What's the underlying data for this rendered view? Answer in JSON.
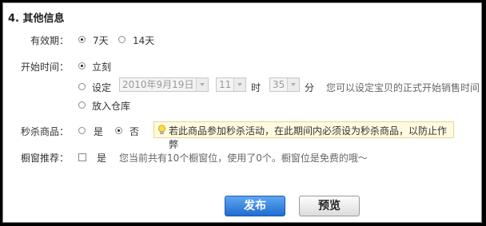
{
  "section_title": "4. 其他信息",
  "validity": {
    "label": "有效期：",
    "options": [
      {
        "label": "7天",
        "selected": true
      },
      {
        "label": "14天",
        "selected": false
      }
    ]
  },
  "start_time": {
    "label": "开始时间：",
    "immediate": {
      "label": "立刻",
      "selected": true
    },
    "scheduled": {
      "label": "设定",
      "selected": false
    },
    "date_value": "2010年9月19日",
    "hour_value": "11",
    "hour_unit": "时",
    "minute_value": "35",
    "minute_unit": "分",
    "hint": "您可以设定宝贝的正式开始销售时间",
    "warehouse": {
      "label": "放入仓库",
      "selected": false
    }
  },
  "flash_sale": {
    "label": "秒杀商品：",
    "yes": {
      "label": "是",
      "selected": false
    },
    "no": {
      "label": "否",
      "selected": true
    },
    "tip": "若此商品参加秒杀活动，在此期间内必须设为秒杀商品，以防止作弊"
  },
  "showcase": {
    "label": "橱窗推荐：",
    "checkbox_label": "是",
    "checked": false,
    "hint": "您当前共有10个橱窗位，使用了0个。橱窗位是免费的哦～"
  },
  "buttons": {
    "publish": "发布",
    "preview": "预览"
  }
}
